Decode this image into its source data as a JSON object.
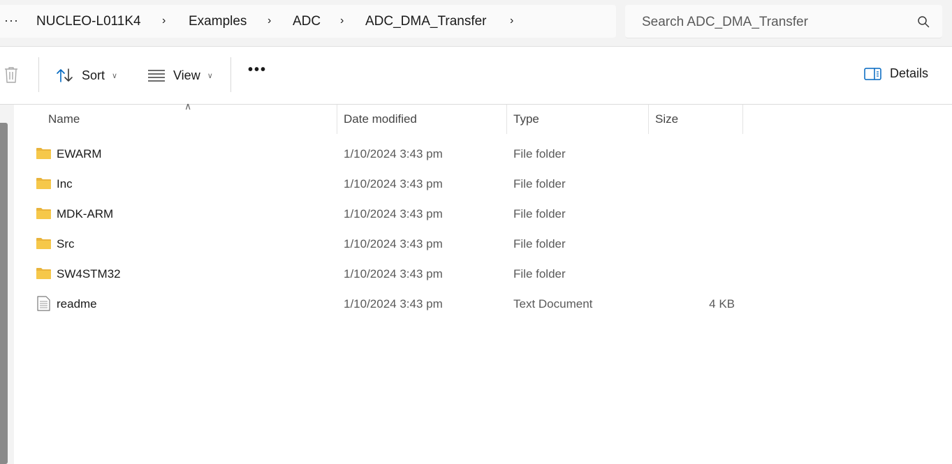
{
  "breadcrumb": {
    "more": "···",
    "items": [
      "NUCLEO-L011K4",
      "Examples",
      "ADC",
      "ADC_DMA_Transfer"
    ]
  },
  "search": {
    "placeholder": "Search ADC_DMA_Transfer"
  },
  "toolbar": {
    "sort_label": "Sort",
    "view_label": "View",
    "more_label": "•••",
    "details_label": "Details"
  },
  "columns": {
    "name": "Name",
    "date": "Date modified",
    "type": "Type",
    "size": "Size"
  },
  "files": [
    {
      "name": "EWARM",
      "date": "1/10/2024 3:43 pm",
      "type": "File folder",
      "size": "",
      "icon": "folder-icon"
    },
    {
      "name": "Inc",
      "date": "1/10/2024 3:43 pm",
      "type": "File folder",
      "size": "",
      "icon": "folder-icon"
    },
    {
      "name": "MDK-ARM",
      "date": "1/10/2024 3:43 pm",
      "type": "File folder",
      "size": "",
      "icon": "folder-icon"
    },
    {
      "name": "Src",
      "date": "1/10/2024 3:43 pm",
      "type": "File folder",
      "size": "",
      "icon": "folder-icon"
    },
    {
      "name": "SW4STM32",
      "date": "1/10/2024 3:43 pm",
      "type": "File folder",
      "size": "",
      "icon": "folder-icon"
    },
    {
      "name": "readme",
      "date": "1/10/2024 3:43 pm",
      "type": "Text Document",
      "size": "4 KB",
      "icon": "text-document-icon"
    }
  ],
  "colors": {
    "folder": "#f6c84a",
    "accent": "#0067c0"
  }
}
